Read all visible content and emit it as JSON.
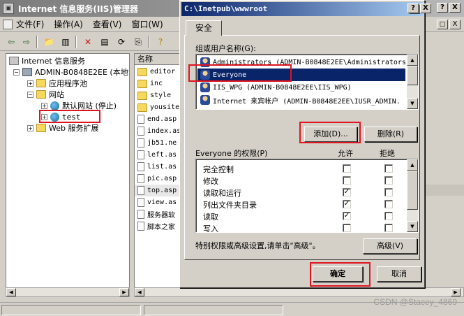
{
  "main_window": {
    "title": "Internet 信息服务(IIS)管理器",
    "controls": [
      "?",
      "X"
    ],
    "inner_controls": [
      "▢",
      "X"
    ]
  },
  "menu": [
    {
      "label": "文件(F)"
    },
    {
      "label": "操作(A)"
    },
    {
      "label": "查看(V)"
    },
    {
      "label": "窗口(W)"
    }
  ],
  "tree": {
    "root": "Internet 信息服务",
    "computer": "ADMIN-B0848E2EE (本地计",
    "app_pools": "应用程序池",
    "websites": "网站",
    "default_site": "默认网站 (停止)",
    "test_site": "test",
    "web_ext": "Web 服务扩展"
  },
  "file_list": {
    "header": "名称",
    "items": [
      "editor",
      "inc",
      "style",
      "yousite",
      "end.asp",
      "index.as",
      "jb51.ne",
      "left.as",
      "list.as",
      "pic.asp",
      "top.asp",
      "view.as",
      "服务器软",
      "脚本之家"
    ]
  },
  "dialog": {
    "title": "C:\\Inetpub\\wwwroot",
    "help_btn": "?",
    "close_btn": "X",
    "tab_security": "安全",
    "groups_label": "组或用户名称(G):",
    "users": [
      "Administrators (ADMIN-B0848E2EE\\Administrators",
      "Everyone",
      "IIS_WPG (ADMIN-B0848E2EE\\IIS_WPG)",
      "Internet 来宾帐户 (ADMIN-B0848E2EE\\IUSR_ADMIN."
    ],
    "selected_user_index": 1,
    "add_btn": "添加(D)...",
    "remove_btn": "删除(R)",
    "perm_label": "Everyone 的权限(P)",
    "allow_header": "允许",
    "deny_header": "拒绝",
    "permissions": [
      {
        "name": "完全控制",
        "allow": false,
        "deny": false
      },
      {
        "name": "修改",
        "allow": false,
        "deny": false
      },
      {
        "name": "读取和运行",
        "allow": true,
        "deny": false
      },
      {
        "name": "列出文件夹目录",
        "allow": true,
        "deny": false
      },
      {
        "name": "读取",
        "allow": true,
        "deny": false
      },
      {
        "name": "写入",
        "allow": false,
        "deny": false
      }
    ],
    "special_text": "特别权限或高级设置,请单击\"高级\"。",
    "advanced_btn": "高级(V)",
    "ok_btn": "确定",
    "cancel_btn": "取消"
  },
  "watermark": "CSDN @Stacey_4869",
  "colors": {
    "highlight": "#e0141e",
    "selection": "#0a246a"
  }
}
